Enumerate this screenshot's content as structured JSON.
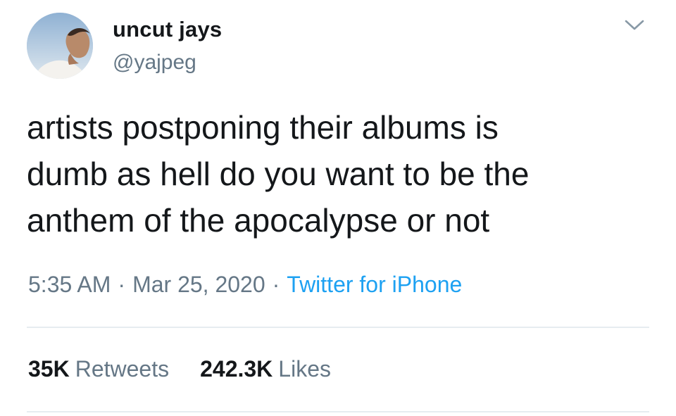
{
  "author": {
    "display_name": "uncut jays",
    "handle": "@yajpeg",
    "avatar_icon": "profile-photo"
  },
  "menu_icon": "chevron-down-icon",
  "tweet": {
    "text_lines": [
      "artists postponing their albums is",
      "dumb as hell do you want to be the",
      "anthem of the apocalypse or not"
    ]
  },
  "meta": {
    "time": "5:35 AM",
    "separator": "·",
    "date": "Mar 25, 2020",
    "source": "Twitter for iPhone"
  },
  "stats": {
    "retweets": {
      "count": "35K",
      "label": "Retweets"
    },
    "likes": {
      "count": "242.3K",
      "label": "Likes"
    }
  },
  "colors": {
    "text": "#14171a",
    "secondary": "#657786",
    "link": "#1da1f2",
    "divider": "#e6ecf0"
  }
}
